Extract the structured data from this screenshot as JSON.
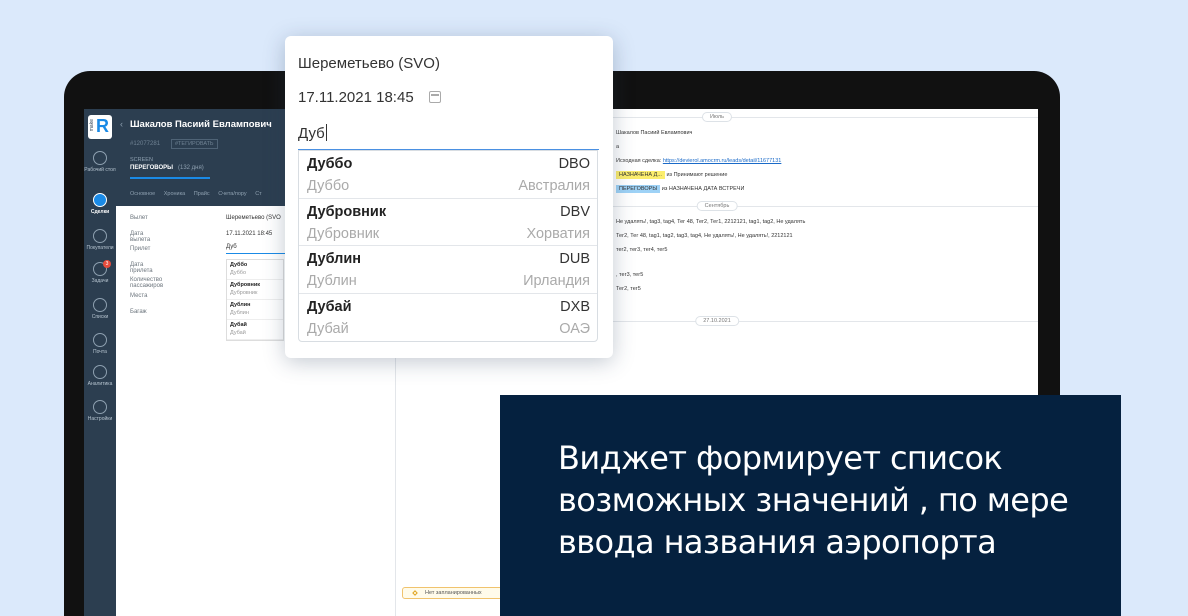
{
  "nav": {
    "logo_text": "make",
    "items": [
      {
        "label": "Рабочий стол",
        "icon": "dashboard-icon",
        "active": false,
        "badge": ""
      },
      {
        "label": "Сделки",
        "icon": "deals-icon",
        "active": true,
        "badge": ""
      },
      {
        "label": "Покупатели",
        "icon": "customers-icon",
        "active": false,
        "badge": ""
      },
      {
        "label": "Задачи",
        "icon": "tasks-icon",
        "active": false,
        "badge": "3"
      },
      {
        "label": "Списки",
        "icon": "lists-icon",
        "active": false,
        "badge": ""
      },
      {
        "label": "Почта",
        "icon": "mail-icon",
        "active": false,
        "badge": ""
      },
      {
        "label": "Аналитика",
        "icon": "analytics-icon",
        "active": false,
        "badge": ""
      },
      {
        "label": "Настройки",
        "icon": "settings-icon",
        "active": false,
        "badge": ""
      }
    ]
  },
  "lead": {
    "name": "Шакалов Пасиий Евлампович",
    "id": "#12077281",
    "tag_button": "#ТЕГИРОВАТЬ",
    "stage_label": "SCREEN",
    "stage_value": "ПЕРЕГОВОРЫ",
    "stage_days": "(132 дня)",
    "tabs": [
      "Основное",
      "Хроника",
      "Прайс",
      "Счета/пору",
      "Ст"
    ],
    "fields": [
      {
        "label": "Вылет",
        "value": "Шереметьево (SVO"
      },
      {
        "label": "Дата вылета",
        "value": "17.11.2021 18:45"
      },
      {
        "label": "Прилет",
        "value": "Дуб"
      },
      {
        "label": "Дата прилета",
        "value": ""
      },
      {
        "label": "Количество пассажиров",
        "value": ""
      },
      {
        "label": "Места",
        "value": ""
      },
      {
        "label": "Багаж",
        "value": ""
      }
    ]
  },
  "feed": {
    "dates": [
      "Июль",
      "Сентябрь",
      "27.10.2021"
    ],
    "lines": [
      {
        "text": "Шакалов Пасиий Евлампович"
      },
      {
        "text": "а"
      },
      {
        "text": "Исходная сделка: ",
        "link": "https://devierol.amocrm.ru/leads/detail/11677131"
      },
      {
        "chip": "НАЗНАЧЕНА Д...",
        "chip_color": "yellow",
        "text": " из Принимают решение"
      },
      {
        "chip": "ПЕРЕГОВОРЫ",
        "chip_color": "blue",
        "text": " из НАЗНАЧЕНА ДАТА ВСТРЕЧИ"
      },
      {
        "text": "Не удалять!, tag3, tag4, Тег 48, Тег2, Тег1, 2212121, tag1, tag2, Не удалять"
      },
      {
        "text": "Тег2, Тег 48, tag1, tag2, tag3, tag4, Не удалять!, Не удалять!, 2212121"
      },
      {
        "text": "тег2, тег3, тег4, тег5"
      },
      {
        "text": ", тег3, тег5"
      },
      {
        "text": "Тег2, тег5"
      }
    ],
    "planned": "Нет запланированных"
  },
  "popup": {
    "airport": "Шереметьево (SVO)",
    "date": "17.11.2021 18:45",
    "query": "Дуб",
    "options": [
      {
        "city": "Дуббо",
        "code": "DBO",
        "country": "Австралия"
      },
      {
        "city": "Дубровник",
        "code": "DBV",
        "country": "Хорватия"
      },
      {
        "city": "Дублин",
        "code": "DUB",
        "country": "Ирландия"
      },
      {
        "city": "Дубай",
        "code": "DXB",
        "country": "ОАЭ"
      }
    ]
  },
  "promo": {
    "text": "Виджет формирует список\nвозможных значений ,  по мере\nввода названия аэропорта"
  }
}
